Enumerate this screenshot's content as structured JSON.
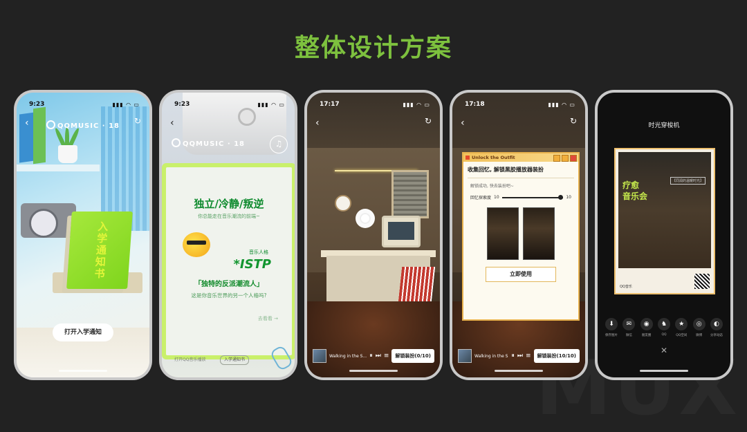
{
  "page": {
    "title": "整体设计方案",
    "watermark": "MUX"
  },
  "phone1": {
    "time": "9:23",
    "brand": "QQMUSIC · 18",
    "notice_label": "入学通知书",
    "button": "打开入学通知"
  },
  "phone2": {
    "time": "9:23",
    "brand": "QQMUSIC · 18",
    "headline": "独立/冷静/叛逆",
    "subline": "你总能走在音乐潮流的前端~",
    "type_label": "音乐人格",
    "type": "*ISTP",
    "quote": "「独特的反派潮流人」",
    "line": "这是你音乐世界的另一个人格吗?",
    "next": "去看看 →",
    "footer_text": "打开QQ音乐播放",
    "footer_btn": "入学通知书"
  },
  "phone3": {
    "time": "17:17",
    "song": "Walking in the S...",
    "unlock_label": "解锁装扮(0/10)"
  },
  "phone4": {
    "time": "17:18",
    "window_bar": "Unlock the Outfit",
    "title": "收集回忆, 解锁黑胶播放器装扮",
    "sub": "解锁成功, 快去装扮吧~",
    "progress_label": "回忆探索度",
    "progress_min": "10",
    "progress_max": "10",
    "use_button": "立即使用",
    "song": "Walking in the S...",
    "unlock_label": "解锁装扮(10/10)"
  },
  "phone5": {
    "title": "时光穿梭机",
    "poster_title_line1": "疗愈",
    "poster_title_line2": "音乐会",
    "poster_tag": "【同润的温暖时光】",
    "poster_footer": "QQ音乐",
    "share": [
      {
        "icon": "download-icon",
        "glyph": "⬇",
        "label": "保存图片"
      },
      {
        "icon": "wechat-icon",
        "glyph": "✉",
        "label": "微信"
      },
      {
        "icon": "moments-icon",
        "glyph": "◉",
        "label": "朋友圈"
      },
      {
        "icon": "qq-icon",
        "glyph": "♞",
        "label": "QQ"
      },
      {
        "icon": "qzone-icon",
        "glyph": "★",
        "label": "QQ空间"
      },
      {
        "icon": "weibo-icon",
        "glyph": "◎",
        "label": "微博"
      },
      {
        "icon": "story-icon",
        "glyph": "◐",
        "label": "分享动态"
      }
    ]
  }
}
